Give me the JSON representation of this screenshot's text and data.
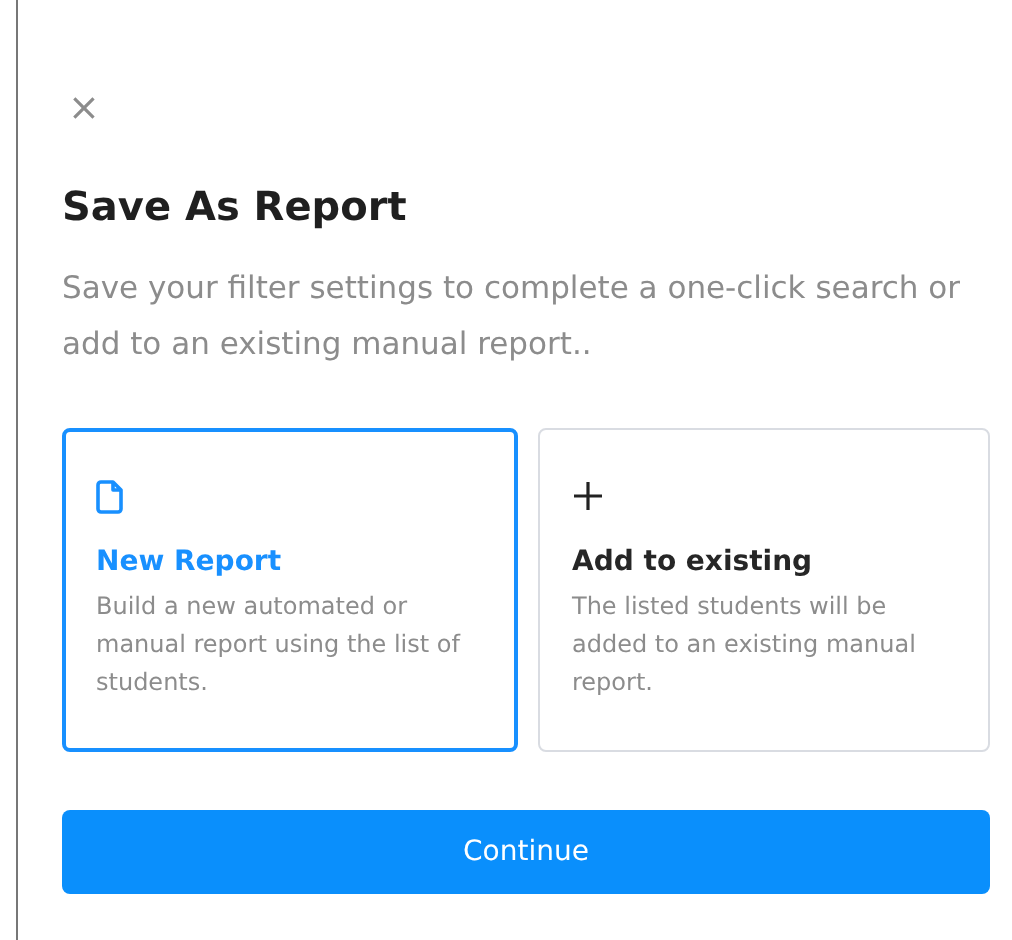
{
  "close_label": "×",
  "title": "Save As Report",
  "description": "Save your filter settings to complete a one-click search or add to an existing manual report..",
  "options": [
    {
      "kind": "file",
      "title": "New Report",
      "description": "Build a new automated or manual report using the list of students.",
      "selected": true
    },
    {
      "kind": "plus",
      "title": "Add to existing",
      "description": "The listed students will be added to an existing manual report.",
      "selected": false
    }
  ],
  "button": "Continue"
}
